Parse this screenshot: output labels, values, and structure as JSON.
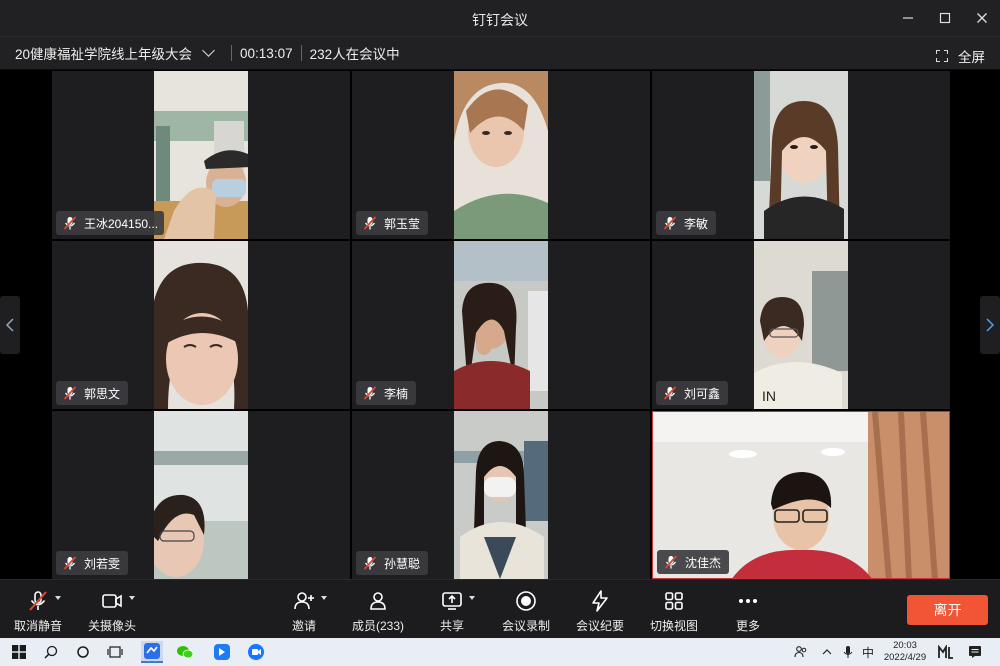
{
  "window": {
    "title": "钉钉会议"
  },
  "infobar": {
    "meeting_name": "20健康福祉学院线上年级大会",
    "elapsed": "00:13:07",
    "participants_in_meeting": "232人在会议中",
    "fullscreen_label": "全屏"
  },
  "participants": [
    {
      "name": "王冰204150...",
      "muted": true
    },
    {
      "name": "郭玉莹",
      "muted": true
    },
    {
      "name": "李敏",
      "muted": true
    },
    {
      "name": "郭思文",
      "muted": true
    },
    {
      "name": "李楠",
      "muted": true
    },
    {
      "name": "刘可鑫",
      "muted": true
    },
    {
      "name": "刘若雯",
      "muted": true
    },
    {
      "name": "孙慧聪",
      "muted": true
    },
    {
      "name": "沈佳杰",
      "muted": true
    }
  ],
  "toolbar": {
    "unmute": "取消静音",
    "camera_off": "关摄像头",
    "invite": "邀请",
    "members": "成员(233)",
    "share": "共享",
    "record": "会议录制",
    "minutes": "会议纪要",
    "switch_view": "切换视图",
    "more": "更多",
    "leave": "离开"
  },
  "taskbar": {
    "ime": "中",
    "time": "20:03",
    "date": "2022/4/29"
  },
  "colors": {
    "leave_button": "#f25535",
    "muted_mic": "#e0452e",
    "active_speaker_border": "#c9343a"
  }
}
